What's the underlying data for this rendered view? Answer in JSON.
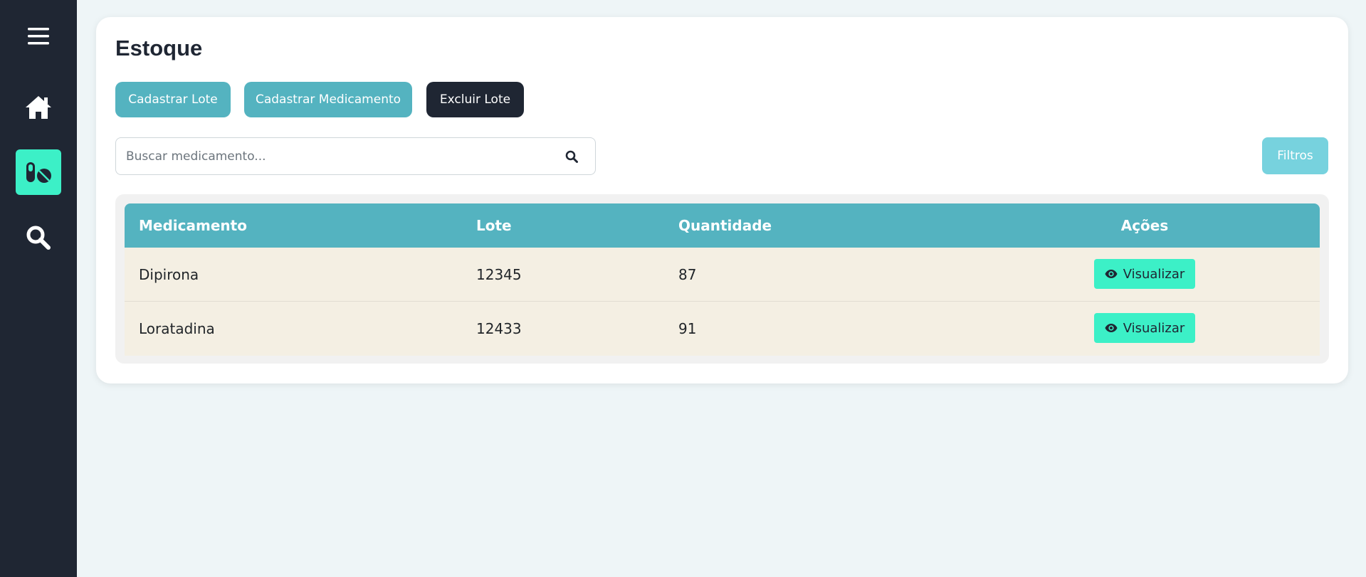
{
  "sidebar": {
    "items": [
      {
        "icon": "menu-icon"
      },
      {
        "icon": "home-icon"
      },
      {
        "icon": "pills-icon",
        "active": true
      },
      {
        "icon": "search-icon"
      }
    ],
    "active_color": "#3cf0c7",
    "background": "#1f2633"
  },
  "page": {
    "title": "Estoque"
  },
  "toolbar": {
    "cadastrar_lote": "Cadastrar Lote",
    "cadastrar_medicamento": "Cadastrar Medicamento",
    "excluir_lote": "Excluir Lote"
  },
  "search": {
    "placeholder": "Buscar medicamento...",
    "value": ""
  },
  "filters": {
    "label": "Filtros"
  },
  "table": {
    "headers": {
      "medicamento": "Medicamento",
      "lote": "Lote",
      "quantidade": "Quantidade",
      "acoes": "Ações"
    },
    "rows": [
      {
        "medicamento": "Dipirona",
        "lote": "12345",
        "quantidade": "87",
        "action": "Visualizar"
      },
      {
        "medicamento": "Loratadina",
        "lote": "12433",
        "quantidade": "91",
        "action": "Visualizar"
      }
    ]
  },
  "colors": {
    "accent": "#54b3c0",
    "mint": "#3cf0c7",
    "dark": "#1f2633",
    "row_bg": "#f4efe3"
  }
}
